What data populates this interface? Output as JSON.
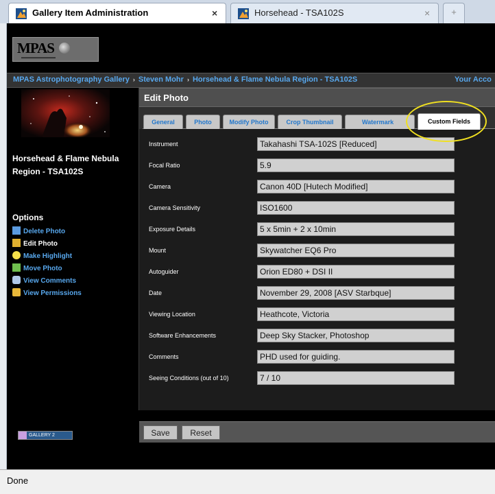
{
  "browser": {
    "tabs": [
      {
        "title": "Gallery Item Administration",
        "close": "×"
      },
      {
        "title": "Horsehead - TSA102S",
        "close": "×"
      }
    ],
    "new_tab": "+",
    "status": "Done"
  },
  "site": {
    "logo": "MPAS",
    "breadcrumb": [
      "MPAS Astrophotography Gallery",
      "Steven Mohr",
      "Horsehead & Flame Nebula Region - TSA102S"
    ],
    "breadcrumb_separator": "›",
    "account": "Your Acco"
  },
  "sidebar": {
    "photo_title": "Horsehead & Flame Nebula Region - TSA102S",
    "options_title": "Options",
    "options": [
      {
        "label": "Delete Photo",
        "icon": "delete-photo-icon",
        "color": "#5b9be0"
      },
      {
        "label": "Edit Photo",
        "icon": "edit-photo-icon",
        "color": "#e0b030"
      },
      {
        "label": "Make Highlight",
        "icon": "lightbulb-icon",
        "color": "#f5e04a"
      },
      {
        "label": "Move Photo",
        "icon": "move-photo-icon",
        "color": "#6fbf4f"
      },
      {
        "label": "View Comments",
        "icon": "comments-icon",
        "color": "#b0c8e8"
      },
      {
        "label": "View Permissions",
        "icon": "lock-icon",
        "color": "#e8b83a"
      }
    ]
  },
  "main": {
    "header": "Edit Photo",
    "tabs": [
      "General",
      "Photo",
      "Modify Photo",
      "Crop Thumbnail",
      "Watermark",
      "Custom Fields"
    ],
    "active_tab": "Custom Fields",
    "fields": [
      {
        "label": "Instrument",
        "value": "Takahashi TSA-102S [Reduced]"
      },
      {
        "label": "Focal Ratio",
        "value": "5.9"
      },
      {
        "label": "Camera",
        "value": "Canon 40D [Hutech Modified]"
      },
      {
        "label": "Camera Sensitivity",
        "value": "ISO1600"
      },
      {
        "label": "Exposure Details",
        "value": "5 x 5min + 2 x 10min"
      },
      {
        "label": "Mount",
        "value": "Skywatcher EQ6 Pro"
      },
      {
        "label": "Autoguider",
        "value": "Orion ED80 + DSI II"
      },
      {
        "label": "Date",
        "value": "November 29, 2008 [ASV Starbque]"
      },
      {
        "label": "Viewing Location",
        "value": "Heathcote, Victoria"
      },
      {
        "label": "Software Enhancements",
        "value": "Deep Sky Stacker, Photoshop"
      },
      {
        "label": "Comments",
        "value": "PHD used for guiding."
      },
      {
        "label": "Seeing Conditions (out of 10)",
        "value": "7 / 10"
      }
    ],
    "save_label": "Save",
    "reset_label": "Reset"
  },
  "footer": {
    "badge": "GALLERY 2"
  },
  "colors": {
    "link": "#58a8ee",
    "highlight_circle": "#f0e020"
  }
}
